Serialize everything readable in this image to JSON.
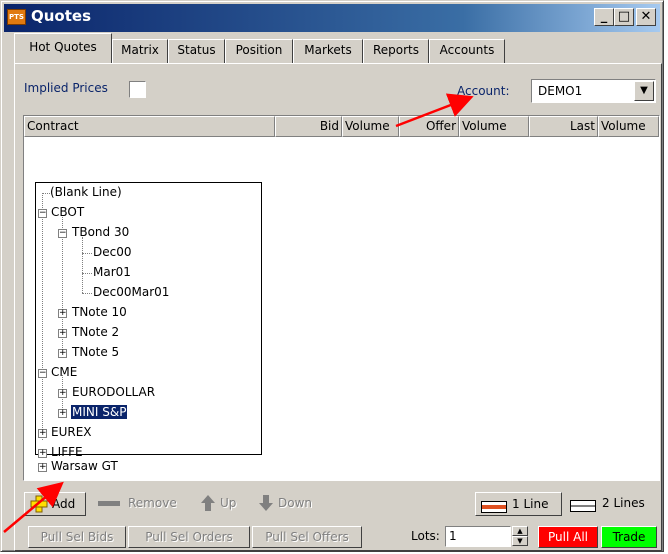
{
  "window": {
    "title": "Quotes",
    "app_icon_text": "PTS"
  },
  "titlebar_buttons": {
    "minimize": "_",
    "maximize": "□",
    "close": "✕"
  },
  "tabs": [
    "Hot Quotes",
    "Matrix",
    "Status",
    "Position",
    "Markets",
    "Reports",
    "Accounts"
  ],
  "implied_prices_label": "Implied Prices",
  "account": {
    "label": "Account:",
    "value": "DEMO1"
  },
  "columns": [
    "Contract",
    "Bid",
    "Volume",
    "Offer",
    "Volume",
    "Last",
    "Volume"
  ],
  "tree": {
    "blank": "(Blank Line)",
    "cbot": "CBOT",
    "tbond30": "TBond 30",
    "dec00": "Dec00",
    "mar01": "Mar01",
    "dec00mar01": "Dec00Mar01",
    "tnote10": "TNote 10",
    "tnote2": "TNote 2",
    "tnote5": "TNote 5",
    "cme": "CME",
    "eurodollar": "EURODOLLAR",
    "minisp": "MINI S&P",
    "eurex": "EUREX",
    "liffe": "LIFFE",
    "warsaw": "Warsaw GT"
  },
  "toolbar": {
    "add": "Add",
    "remove": "Remove",
    "up": "Up",
    "down": "Down",
    "one_line": "1 Line",
    "two_lines": "2 Lines"
  },
  "actions": {
    "pull_sel_bids": "Pull Sel Bids",
    "pull_sel_orders": "Pull Sel Orders",
    "pull_sel_offers": "Pull Sel Offers",
    "lots_label": "Lots:",
    "lots_value": "1",
    "pull_all": "Pull All",
    "trade": "Trade"
  },
  "colors": {
    "title_gradient_start": "#0a246a",
    "selection": "#0a246a",
    "pull_all": "#ff0000",
    "trade": "#00ff00",
    "annotation_arrow": "#ff0000"
  }
}
